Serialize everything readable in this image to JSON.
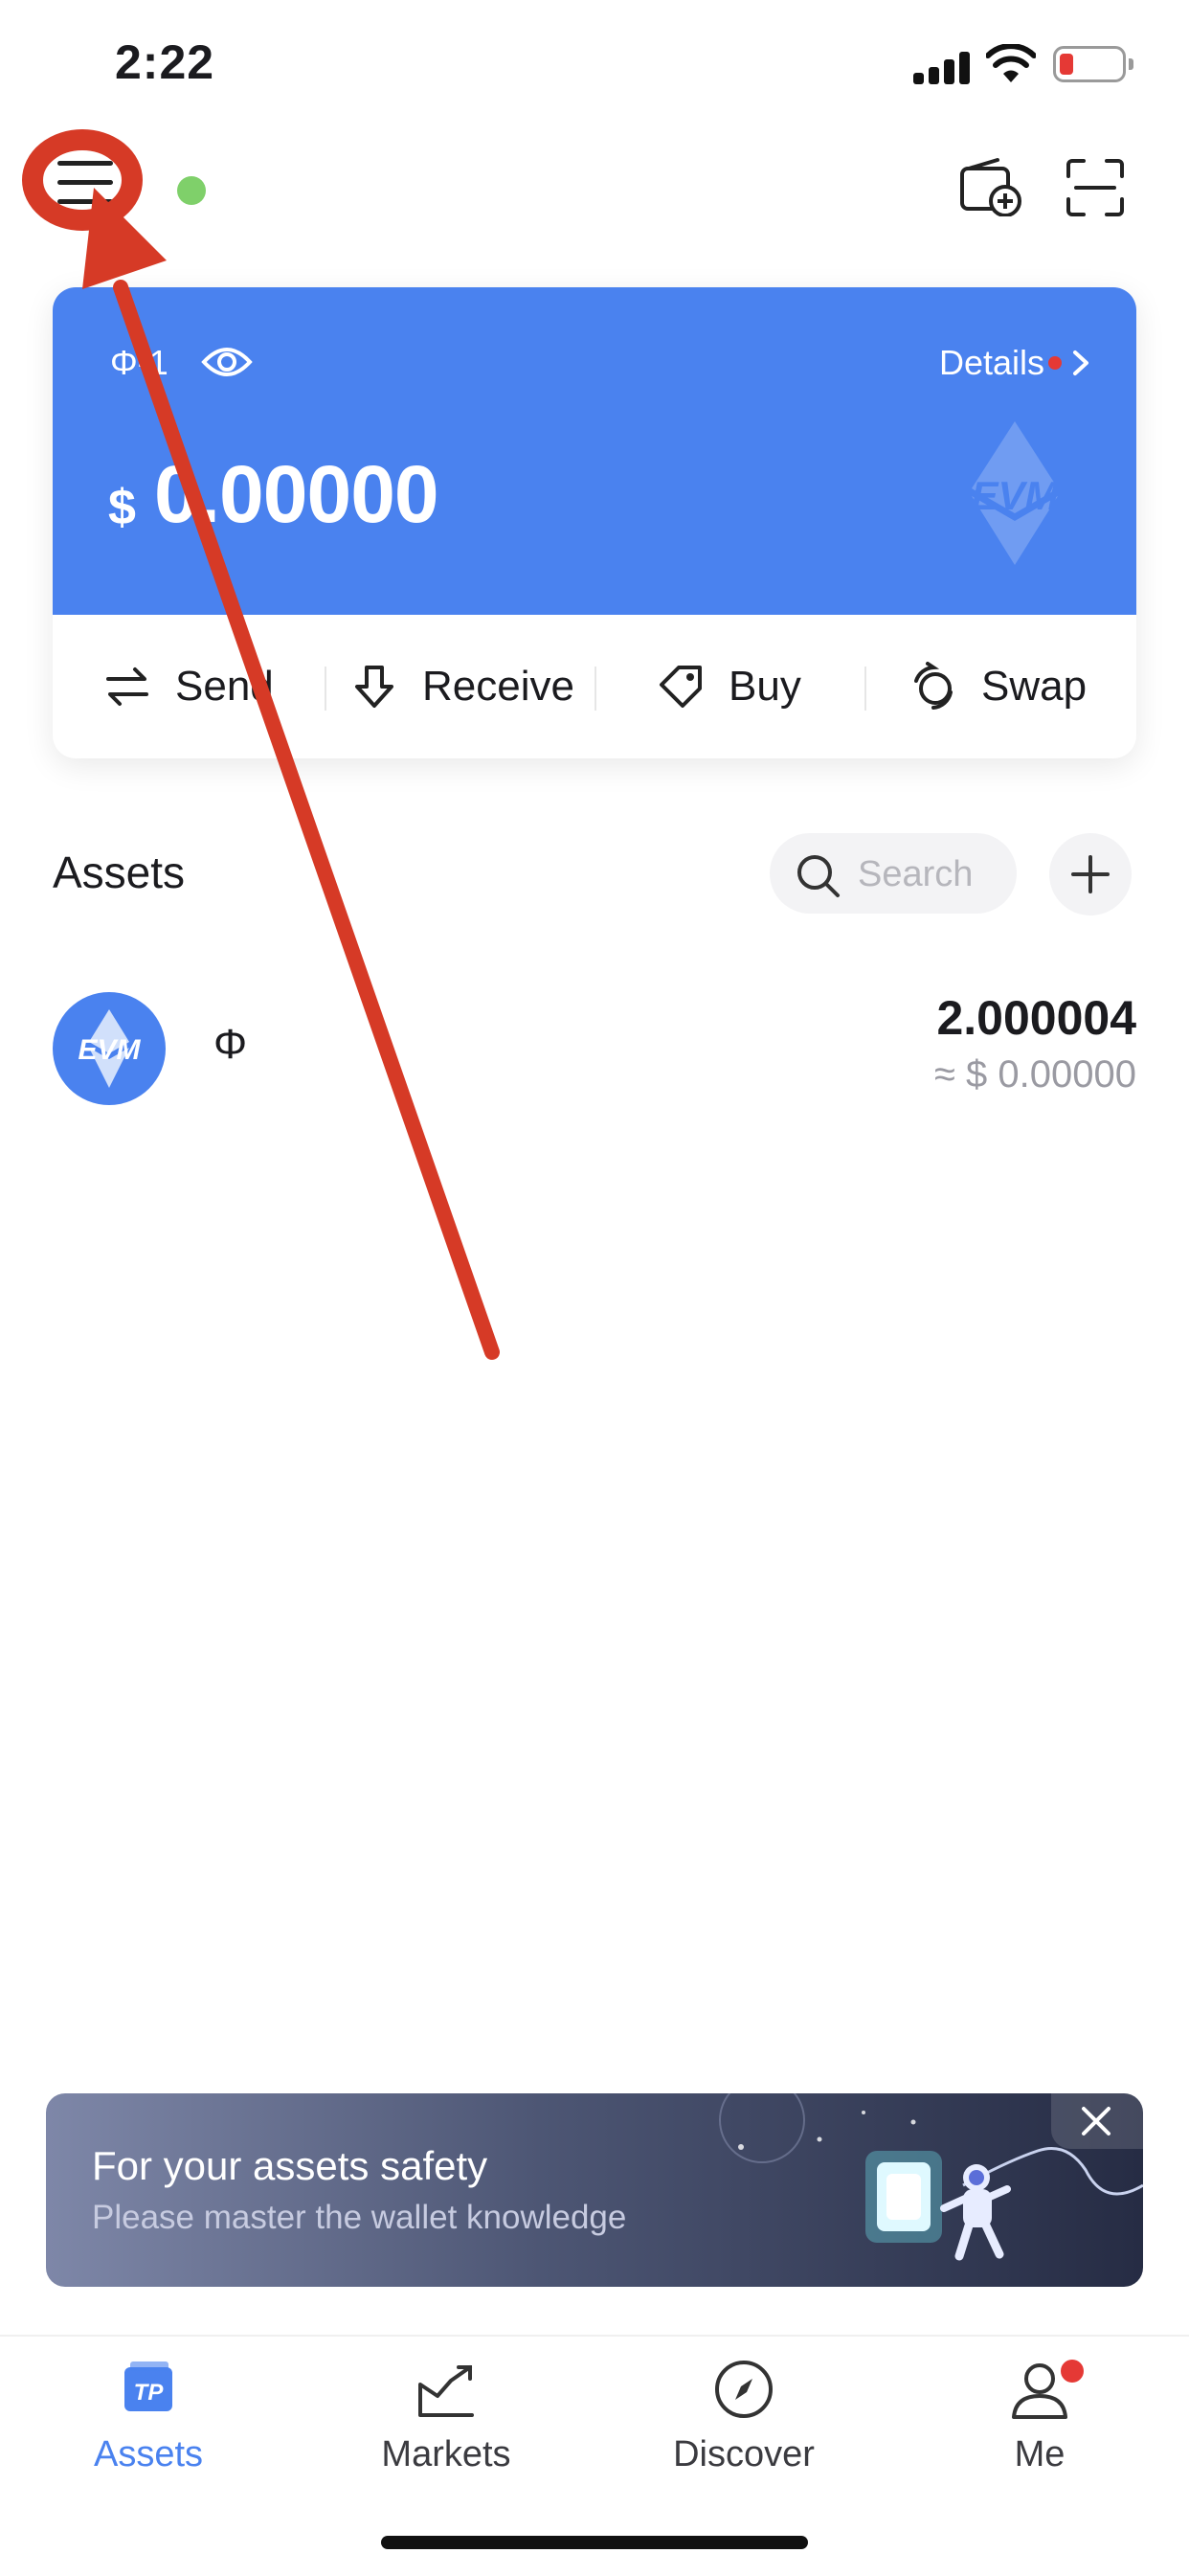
{
  "status_bar": {
    "time": "2:22"
  },
  "header": {
    "menu_icon": "menu-icon",
    "online_color": "#7fd06a"
  },
  "card": {
    "wallet_name": "Φ-1",
    "details_label": "Details",
    "currency": "$",
    "balance": "0.00000",
    "accent": "#4a82ef",
    "watermark": "EVM"
  },
  "actions": [
    {
      "label": "Send",
      "icon": "transfer-icon"
    },
    {
      "label": "Receive",
      "icon": "download-icon"
    },
    {
      "label": "Buy",
      "icon": "tag-icon"
    },
    {
      "label": "Swap",
      "icon": "swap-icon"
    }
  ],
  "assets": {
    "title": "Assets",
    "search_placeholder": "Search",
    "tokens": [
      {
        "symbol": "Φ",
        "icon_text": "EVM",
        "amount": "2.000004",
        "fiat": "≈ $ 0.00000"
      }
    ]
  },
  "banner": {
    "title": "For your assets safety",
    "subtitle": "Please master the wallet knowledge"
  },
  "tabs": [
    {
      "label": "Assets",
      "icon": "tp-wallet-icon",
      "active": true
    },
    {
      "label": "Markets",
      "icon": "chart-icon",
      "active": false
    },
    {
      "label": "Discover",
      "icon": "compass-icon",
      "active": false
    },
    {
      "label": "Me",
      "icon": "user-icon",
      "active": false
    }
  ],
  "annotation": {
    "color": "#d63a26"
  }
}
